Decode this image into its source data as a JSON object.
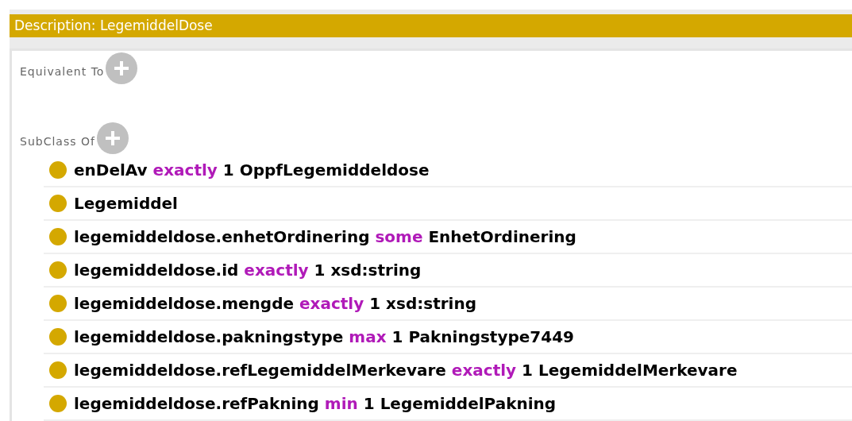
{
  "header": {
    "title": "Description: LegemiddelDose"
  },
  "sections": [
    {
      "label": "Equivalent To"
    },
    {
      "label": "SubClass Of",
      "rows": [
        {
          "parts": [
            {
              "kind": "name",
              "text": "enDelAv"
            },
            {
              "kind": "keyword",
              "text": "exactly"
            },
            {
              "kind": "name",
              "text": "1 OppfLegemiddeldose"
            }
          ]
        },
        {
          "parts": [
            {
              "kind": "name",
              "text": "Legemiddel"
            }
          ]
        },
        {
          "parts": [
            {
              "kind": "name",
              "text": "legemiddeldose.enhetOrdinering"
            },
            {
              "kind": "keyword",
              "text": "some"
            },
            {
              "kind": "name",
              "text": "EnhetOrdinering"
            }
          ]
        },
        {
          "parts": [
            {
              "kind": "name",
              "text": "legemiddeldose.id"
            },
            {
              "kind": "keyword",
              "text": "exactly"
            },
            {
              "kind": "name",
              "text": "1 xsd:string"
            }
          ]
        },
        {
          "parts": [
            {
              "kind": "name",
              "text": "legemiddeldose.mengde"
            },
            {
              "kind": "keyword",
              "text": "exactly"
            },
            {
              "kind": "name",
              "text": "1 xsd:string"
            }
          ]
        },
        {
          "parts": [
            {
              "kind": "name",
              "text": "legemiddeldose.pakningstype"
            },
            {
              "kind": "keyword",
              "text": "max"
            },
            {
              "kind": "name",
              "text": "1 Pakningstype7449"
            }
          ]
        },
        {
          "parts": [
            {
              "kind": "name",
              "text": "legemiddeldose.refLegemiddelMerkevare"
            },
            {
              "kind": "keyword",
              "text": "exactly"
            },
            {
              "kind": "name",
              "text": "1 LegemiddelMerkevare"
            }
          ]
        },
        {
          "parts": [
            {
              "kind": "name",
              "text": "legemiddeldose.refPakning"
            },
            {
              "kind": "keyword",
              "text": "min"
            },
            {
              "kind": "name",
              "text": "1 LegemiddelPakning"
            }
          ]
        }
      ]
    }
  ]
}
